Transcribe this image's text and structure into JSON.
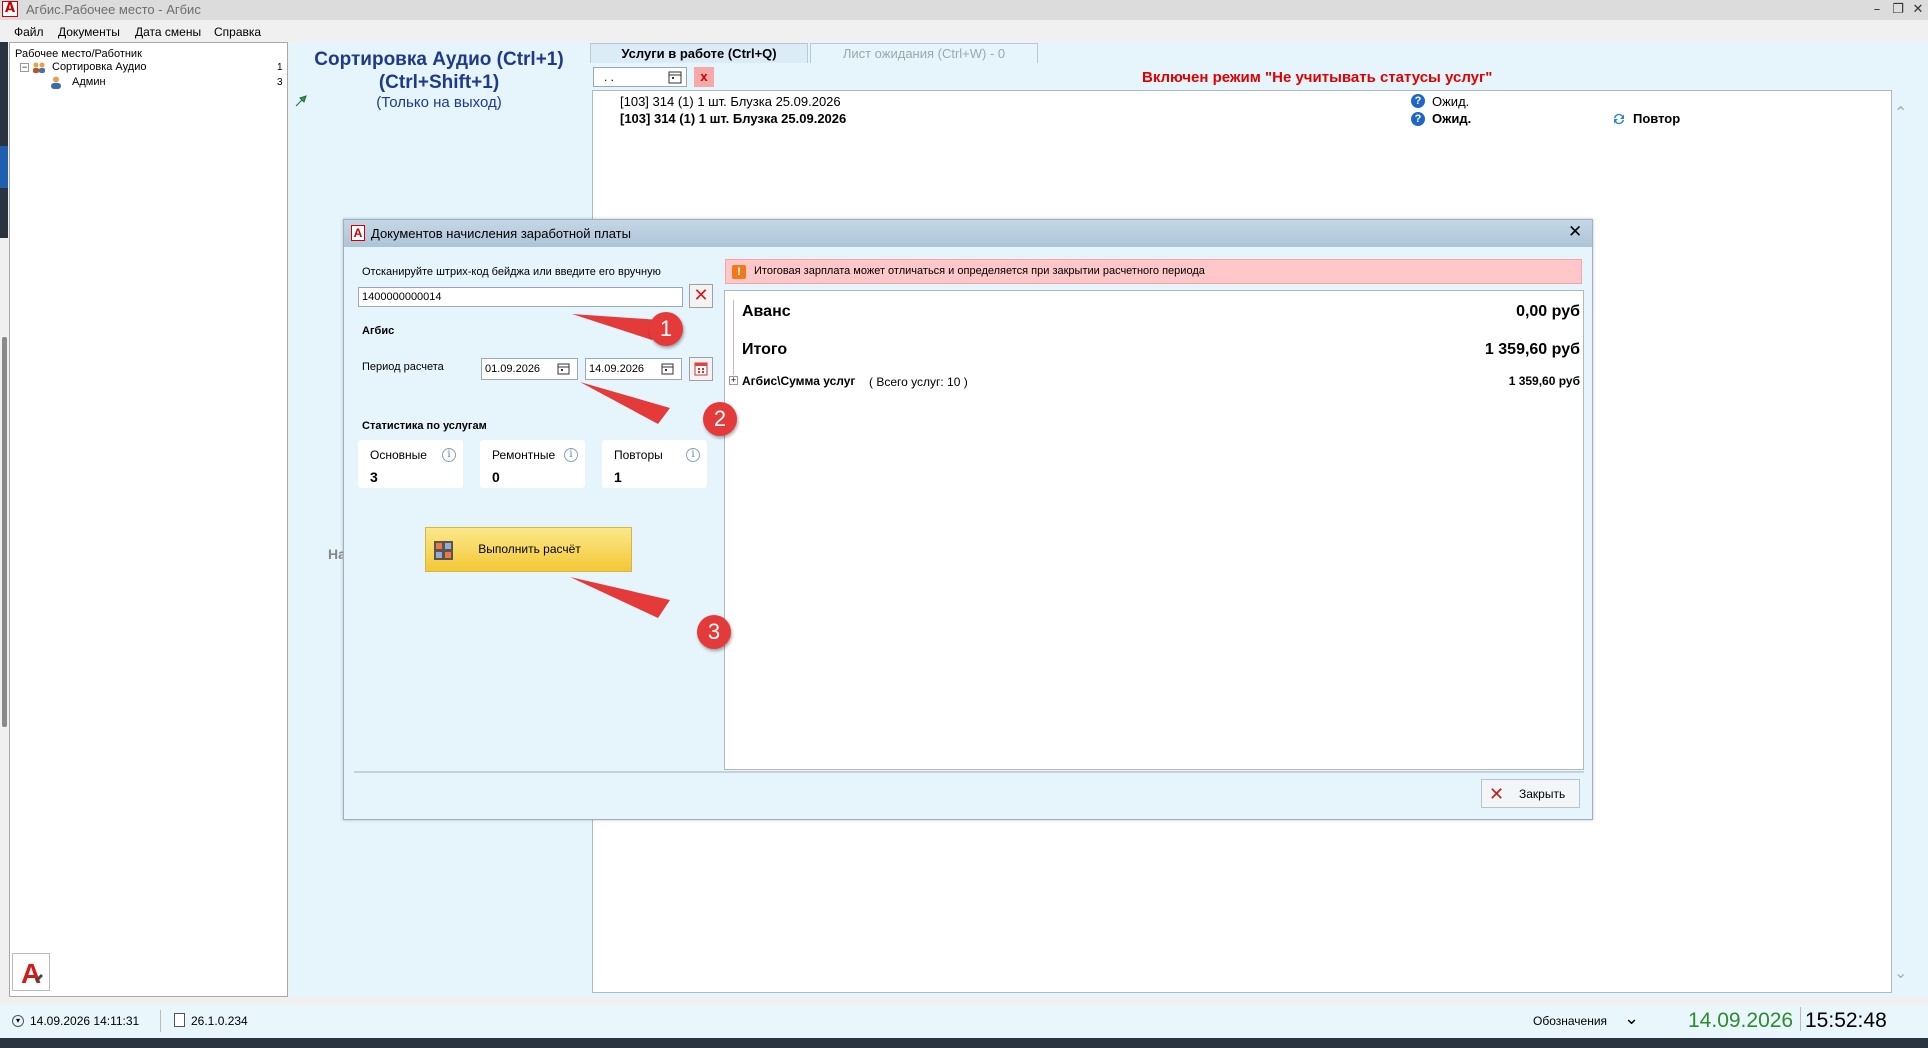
{
  "window": {
    "title": "Агбис.Рабочее место - Агбис"
  },
  "menu": [
    "Файл",
    "Документы",
    "Дата смены",
    "Справка"
  ],
  "tree": {
    "root": "Рабочее место/Работник",
    "group": {
      "label": "Сортировка Аудио",
      "count": "1"
    },
    "child": {
      "label": "Админ",
      "count": "3"
    }
  },
  "center": {
    "title_line1": "Сортировка Аудио (Ctrl+1)",
    "title_line2": "(Ctrl+Shift+1)",
    "subtitle": "(Только на выход)",
    "partial_text": "На"
  },
  "tabs": [
    {
      "label": "Услуги в работе (Ctrl+Q)",
      "active": true
    },
    {
      "label": "Лист ожидания (Ctrl+W) - 0",
      "active": false
    }
  ],
  "filter": {
    "date_value": ". .",
    "clear_label": "x"
  },
  "mode_banner": "Включен режим \"Не учитывать статусы услуг\"",
  "list_rows": [
    {
      "text": "[103] 314 (1) 1 шт. Блузка  25.09.2026",
      "status": "Ожид.",
      "extra": ""
    },
    {
      "text": "[103] 314 (1) 1 шт. Блузка  25.09.2026",
      "status": "Ожид.",
      "extra": "Повтор"
    }
  ],
  "modal": {
    "title": "Документов начисления заработной платы",
    "scan_label": "Отсканируйте штрих-код бейджа или введите его вручную",
    "barcode_value": "1400000000014",
    "employee": "Агбис",
    "period_label": "Период расчета",
    "date_from": "01.09.2026",
    "date_to": "14.09.2026",
    "stats_title": "Статистика по услугам",
    "stats": [
      {
        "label": "Основные",
        "value": "3"
      },
      {
        "label": "Ремонтные",
        "value": "0"
      },
      {
        "label": "Повторы",
        "value": "1"
      }
    ],
    "run_button": "Выполнить расчёт",
    "warning": "Итоговая зарплата может отличаться и определяется при закрытии расчетного периода",
    "results": {
      "advance_label": "Аванс",
      "advance_value": "0,00 руб",
      "total_label": "Итого",
      "total_value": "1 359,60 руб",
      "services_label": "Агбис\\Сумма услуг",
      "services_note": "( Всего услуг: 10 )",
      "services_value": "1 359,60 руб"
    },
    "close_button": "Закрыть"
  },
  "callouts": [
    "1",
    "2",
    "3"
  ],
  "statusbar": {
    "shift_time": "14.09.2026 14:11:31",
    "version": "26.1.0.234",
    "legend_label": "Обозначения",
    "date": "14.09.2026",
    "time": "15:52:48"
  },
  "colors": {
    "banner_red": "#e00000",
    "title_blue": "#1f3a8a",
    "date_green": "#2e8b2e",
    "callout_red": "#e53a3a"
  }
}
